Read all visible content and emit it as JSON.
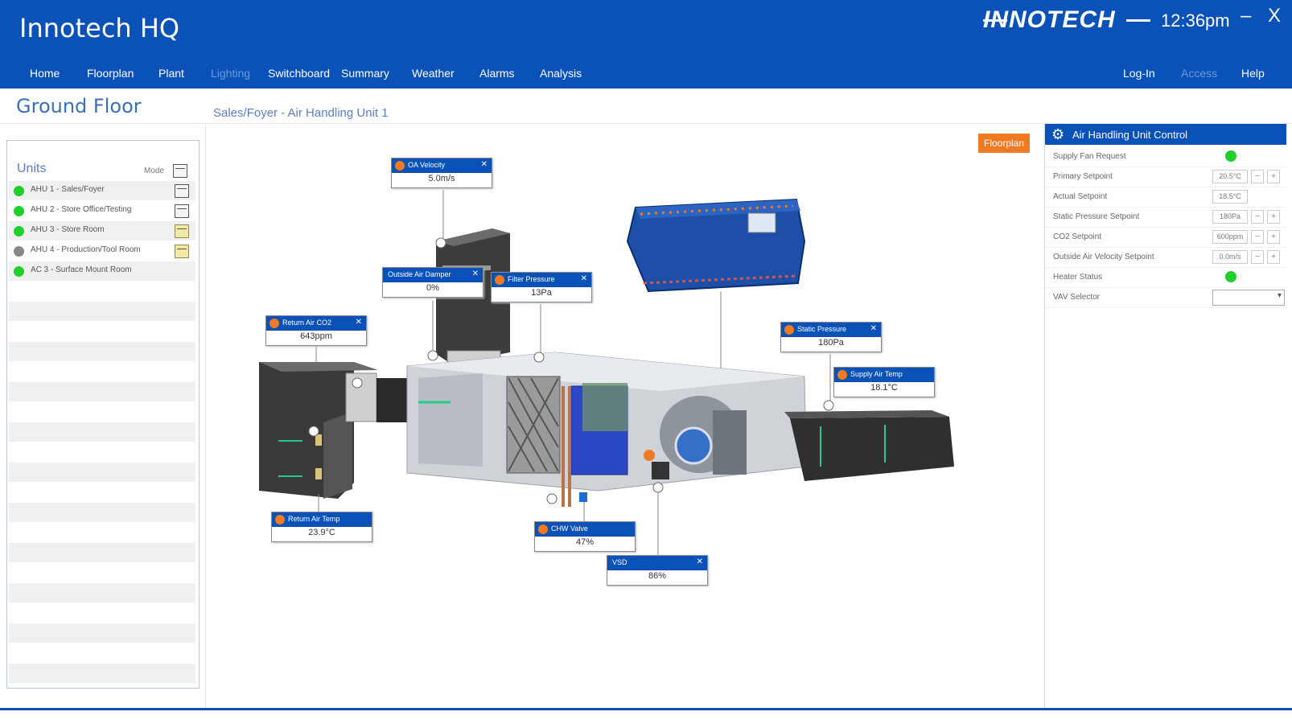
{
  "app": {
    "title": "Innotech HQ",
    "brand": "INNOTECH",
    "clock": "12:36pm",
    "minimize": "–",
    "close": "X"
  },
  "nav": {
    "left": [
      "Home",
      "Floorplan",
      "Plant",
      "Lighting",
      "Switchboard",
      "Summary",
      "Weather",
      "Alarms",
      "Analysis"
    ],
    "right": [
      "Log-In",
      "Access",
      "Help"
    ]
  },
  "page": {
    "title": "Ground Floor",
    "breadcrumb": "Sales/Foyer - Air Handling Unit 1",
    "floorplan_button": "Floorplan"
  },
  "units": {
    "label": "Units",
    "mode_label": "Mode",
    "items": [
      {
        "name": "AHU 1 - Sales/Foyer",
        "status_color": "#1fcf2a"
      },
      {
        "name": "AHU 2 - Store Office/Testing",
        "status_color": "#1fcf2a"
      },
      {
        "name": "AHU 3 - Store Room",
        "status_color": "#1fcf2a"
      },
      {
        "name": "AHU 4 - Production/Tool Room",
        "status_color": "#888888"
      },
      {
        "name": "AC 3 - Surface Mount Room",
        "status_color": "#1fcf2a"
      }
    ]
  },
  "control": {
    "title": "Air Handling Unit Control",
    "rows": [
      {
        "label": "Supply Fan Request",
        "value": "",
        "kind": "led"
      },
      {
        "label": "Primary Setpoint",
        "value": "20.5°C",
        "kind": "stepper"
      },
      {
        "label": "Actual Setpoint",
        "value": "18.5°C",
        "kind": "value"
      },
      {
        "label": "Static Pressure Setpoint",
        "value": "180Pa",
        "kind": "stepper"
      },
      {
        "label": "CO2 Setpoint",
        "value": "600ppm",
        "kind": "stepper"
      },
      {
        "label": "Outside Air Velocity Setpoint",
        "value": "0.0m/s",
        "kind": "stepper"
      },
      {
        "label": "Heater Status",
        "value": "",
        "kind": "led"
      },
      {
        "label": "VAV Selector",
        "value": "",
        "kind": "select"
      }
    ]
  },
  "points": [
    {
      "title": "OA Velocity",
      "value": "5.0m/s"
    },
    {
      "title": "Outside Air Damper",
      "value": "0%"
    },
    {
      "title": "Filter Pressure",
      "value": "13Pa"
    },
    {
      "title": "Return Air CO2",
      "value": "643ppm"
    },
    {
      "title": "Static Pressure",
      "value": "180Pa"
    },
    {
      "title": "Supply Air Temp",
      "value": "18.1°C"
    },
    {
      "title": "Return Air Temp",
      "value": "23.9°C"
    },
    {
      "title": "CHW Valve",
      "value": "47%"
    },
    {
      "title": "VSD",
      "value": "86%"
    }
  ],
  "colors": {
    "header_blue": "#0a52b8",
    "accent_orange": "#f07a22",
    "status_green": "#1fcf2a"
  }
}
